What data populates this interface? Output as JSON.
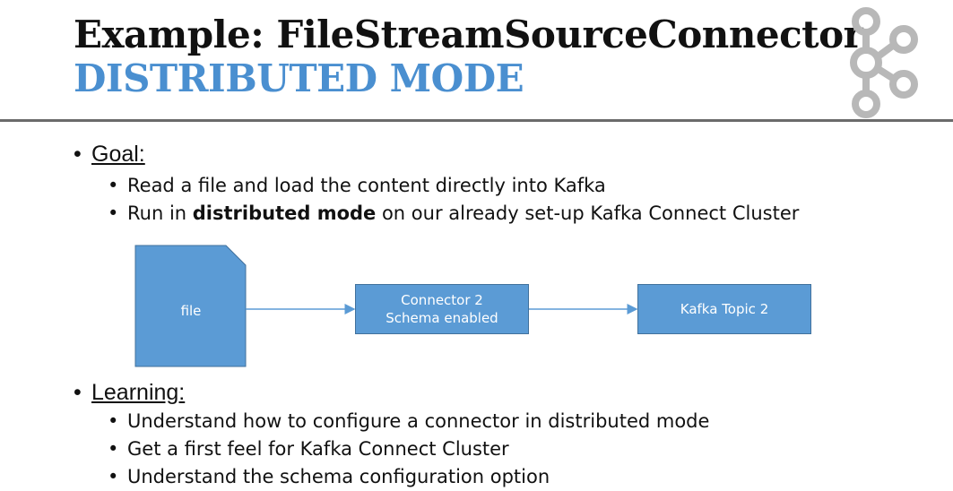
{
  "slide": {
    "title": "Example: FileStreamSourceConnector",
    "subtitle": "DISTRIBUTED MODE",
    "goal": {
      "label": "Goal:",
      "items": [
        {
          "text": "Read a file and load the content directly into Kafka"
        },
        {
          "before": "Run in ",
          "bold": "distributed mode",
          "after": " on our already set-up Kafka Connect Cluster"
        }
      ]
    },
    "learning": {
      "label": "Learning:",
      "items": [
        "Understand how to configure a connector in distributed mode",
        "Get a first feel for Kafka Connect Cluster",
        "Understand the schema configuration option"
      ]
    },
    "diagram": {
      "file_label": "file",
      "connector_line1": "Connector 2",
      "connector_line2": "Schema enabled",
      "topic_label": "Kafka Topic 2",
      "box_color": "#5b9bd5",
      "arrow_color": "#5b9bd5"
    },
    "logo_icon": "kafka-logo-icon",
    "accent_color": "#4a8fd0"
  }
}
